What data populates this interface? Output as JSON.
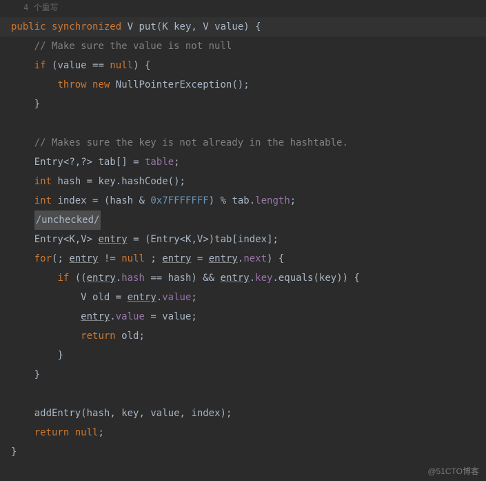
{
  "header_hint": "4 个重写",
  "watermark": "@51CTO博客",
  "kw": {
    "public": "public",
    "synchronized": "synchronized",
    "if": "if",
    "throw": "throw",
    "new": "new",
    "int": "int",
    "for": "for",
    "return": "return",
    "null": "null"
  },
  "types": {
    "V": "V",
    "K": "K",
    "Entry": "Entry",
    "NullPointerException": "NullPointerException"
  },
  "idents": {
    "put": "put",
    "key": "key",
    "value": "value",
    "tab": "tab",
    "table": "table",
    "hash": "hash",
    "hashCode": "hashCode",
    "index": "index",
    "length": "length",
    "entry": "entry",
    "next": "next",
    "equals": "equals",
    "old": "old",
    "addEntry": "addEntry"
  },
  "num": {
    "mask": "0x7FFFFFFF"
  },
  "comments": {
    "c1": "// Make sure the value is not null",
    "c2": "// Makes sure the key is not already in the hashtable.",
    "unchecked": "/unchecked/"
  },
  "sym": {
    "open_paren": "(",
    "close_paren": ")",
    "open_brace": "{",
    "close_brace": "}",
    "open_bracket": "[",
    "close_bracket": "]",
    "open_angle": "<",
    "close_angle": ">",
    "comma": ",",
    "semicolon": ";",
    "eqeq": "==",
    "eq": "=",
    "neq": "!=",
    "dot": ".",
    "amp": "&",
    "andand": "&&",
    "mod": "%",
    "qmark": "?",
    "space": " "
  }
}
